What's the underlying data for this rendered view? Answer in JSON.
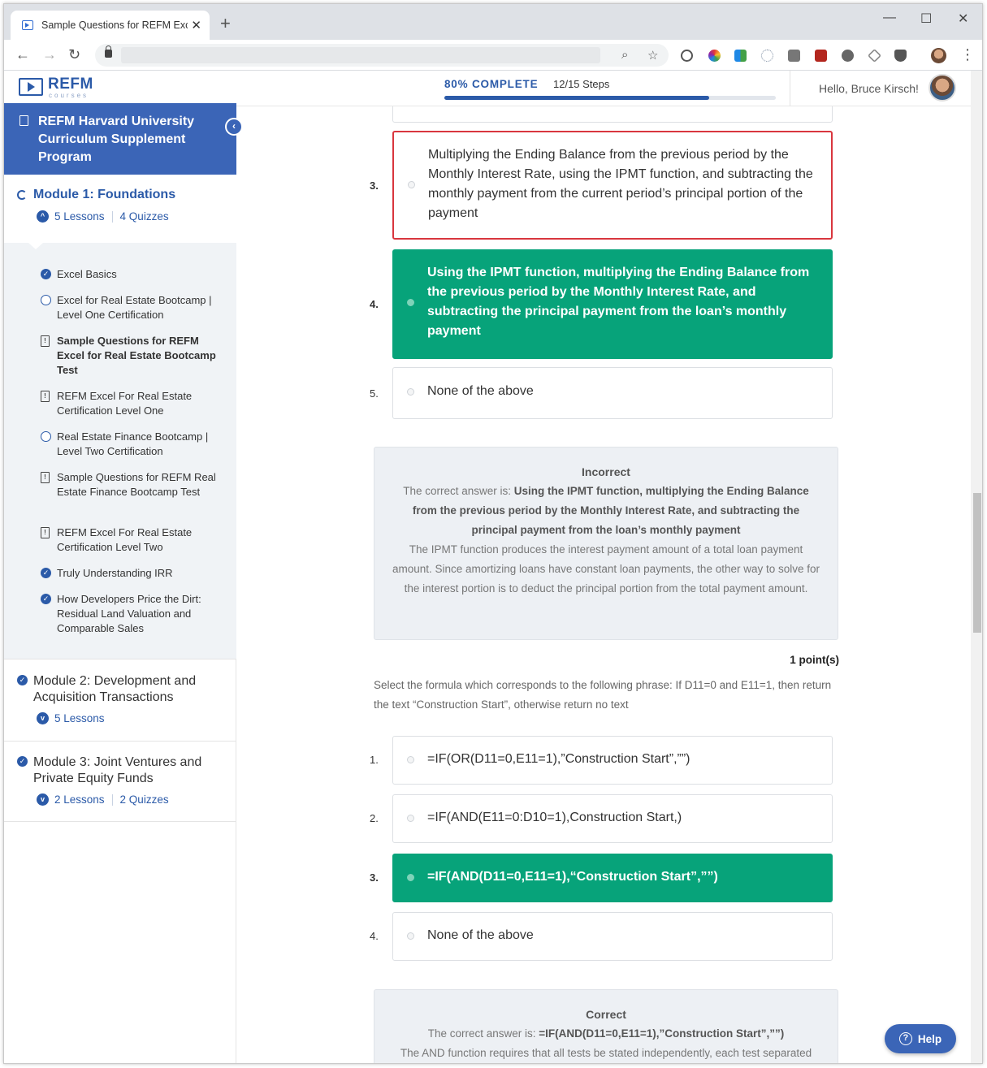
{
  "browser": {
    "tab_title": "Sample Questions for REFM Exce",
    "tab_close": "✕",
    "new_tab": "+",
    "minimize": "—",
    "maximize": "☐",
    "close": "✕",
    "back": "←",
    "forward": "→",
    "reload": "↻",
    "zoom_icon": "⌕",
    "star_icon": "☆",
    "menu_icon": "⋮"
  },
  "header": {
    "logo_brand": "REFM",
    "logo_sub": "courses",
    "progress_label": "80% COMPLETE",
    "progress_value": 0.8,
    "steps": "12/15 Steps",
    "greeting": "Hello, Bruce Kirsch!"
  },
  "sidebar": {
    "course_title": "REFM Harvard University Curriculum Supplement Program",
    "collapse": "‹",
    "modules": [
      {
        "title": "Module 1: Foundations",
        "lessons": "5 Lessons",
        "quizzes": "4 Quizzes",
        "steps": [
          {
            "label": "Excel Basics",
            "icon": "check-icon"
          },
          {
            "label": "Excel for Real Estate Bootcamp | Level One Certification",
            "icon": "empty-circle-icon"
          },
          {
            "label": "Sample Questions for REFM Excel for Real Estate Bootcamp Test",
            "icon": "quiz-icon"
          },
          {
            "label": "REFM Excel For Real Estate Certification Level One",
            "icon": "quiz-icon"
          },
          {
            "label": "Real Estate Finance Bootcamp | Level Two Certification",
            "icon": "empty-circle-icon"
          },
          {
            "label": "Sample Questions for REFM Real Estate Finance Bootcamp Test",
            "icon": "quiz-icon"
          },
          {
            "label": "REFM Excel For Real Estate Certification Level Two",
            "icon": "quiz-icon"
          },
          {
            "label": "Truly Understanding IRR",
            "icon": "check-icon"
          },
          {
            "label": "How Developers Price the Dirt: Residual Land Valuation and Comparable Sales",
            "icon": "check-icon"
          }
        ]
      },
      {
        "title": "Module 2: Development and Acquisition Transactions",
        "lessons": "5 Lessons"
      },
      {
        "title": "Module 3: Joint Ventures and Private Equity Funds",
        "lessons": "2 Lessons",
        "quizzes": "2 Quizzes"
      }
    ]
  },
  "question1": {
    "answers": [
      {
        "num": "3.",
        "text": "Multiplying the Ending Balance from the previous period by the Monthly Interest Rate, using the IPMT function, and subtracting the monthly payment from the current period’s principal portion of the payment",
        "state": "incorrect"
      },
      {
        "num": "4.",
        "text": "Using the IPMT function, multiplying the Ending Balance from the previous period by the Monthly Interest Rate, and subtracting the principal payment from the loan’s monthly payment",
        "state": "correct"
      },
      {
        "num": "5.",
        "text": "None of the above",
        "state": "neutral"
      }
    ],
    "feedback": {
      "heading": "Incorrect",
      "prefix": "The correct answer is: ",
      "answer": "Using the IPMT function, multiplying the Ending Balance from the previous period by the Monthly Interest Rate, and subtracting the principal payment from the loan’s monthly payment",
      "explanation": "The IPMT function produces the interest payment amount of a total loan payment amount. Since amortizing loans have constant loan payments, the other way to solve for the interest portion is to deduct the principal portion from the total payment amount."
    }
  },
  "question2": {
    "points": "1 point(s)",
    "text": "Select the formula which corresponds to the following phrase: If D11=0 and E11=1, then return the text “Construction Start”, otherwise return no text",
    "answers": [
      {
        "num": "1.",
        "text": "=IF(OR(D11=0,E11=1),”Construction Start”,””)"
      },
      {
        "num": "2.",
        "text": "=IF(AND(E11=0:D10=1),Construction Start,)"
      },
      {
        "num": "3.",
        "text": "=IF(AND(D11=0,E11=1),“Construction Start”,””)"
      },
      {
        "num": "4.",
        "text": "None of the above"
      }
    ],
    "feedback": {
      "heading": "Correct",
      "prefix": "The correct answer is: ",
      "answer": "=IF(AND(D11=0,E11=1),”Construction Start”,””)",
      "explanation": "The AND function requires that all tests be stated independently, each test separated"
    }
  },
  "help": {
    "label": "Help",
    "icon": "?"
  }
}
